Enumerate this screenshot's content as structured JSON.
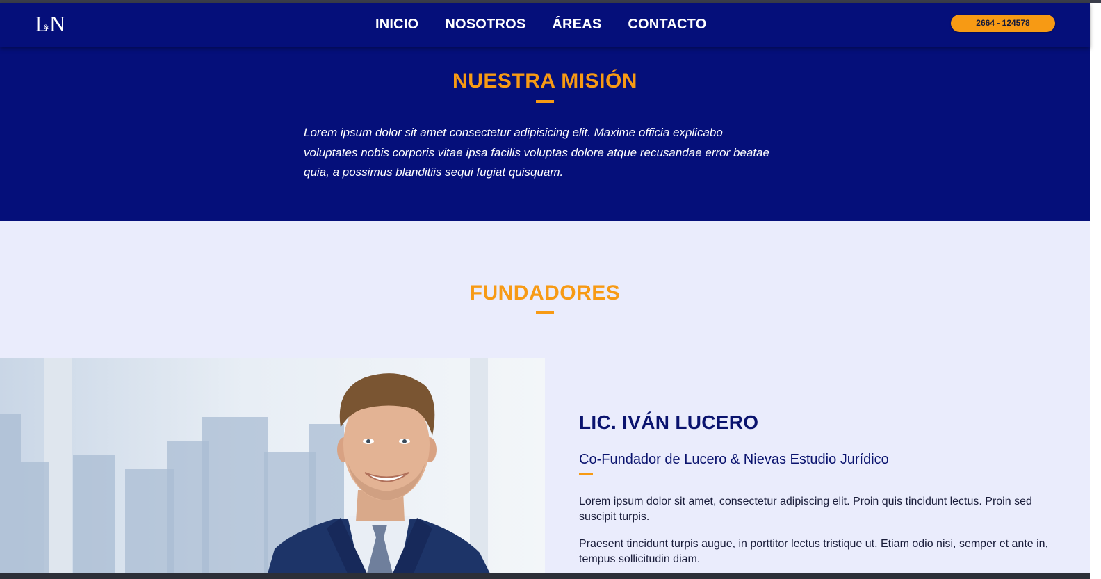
{
  "header": {
    "logo_text": "L&N",
    "nav": [
      "INICIO",
      "NOSOTROS",
      "ÁREAS",
      "CONTACTO"
    ],
    "phone": "2664 - 124578"
  },
  "mission": {
    "title": "NUESTRA MISIÓN",
    "text": "Lorem ipsum dolor sit amet consectetur adipisicing elit. Maxime officia explicabo voluptates nobis corporis vitae ipsa facilis voluptas dolore atque recusandae error beatae quia, a possimus blanditiis sequi fugiat quisquam."
  },
  "founders": {
    "title": "FUNDADORES",
    "person": {
      "name": "LIC. IVÁN LUCERO",
      "role": "Co-Fundador de Lucero & Nievas Estudio Jurídico",
      "paragraphs": [
        "Lorem ipsum dolor sit amet, consectetur adipiscing elit. Proin quis tincidunt lectus. Proin sed suscipit turpis.",
        "Praesent tincidunt turpis augue, in porttitor lectus tristique ut. Etiam odio nisi, semper et ante in, tempus sollicitudin diam."
      ]
    }
  },
  "colors": {
    "navy": "#050f7a",
    "accent": "#f79a14",
    "light_bg": "#eaecfc"
  }
}
